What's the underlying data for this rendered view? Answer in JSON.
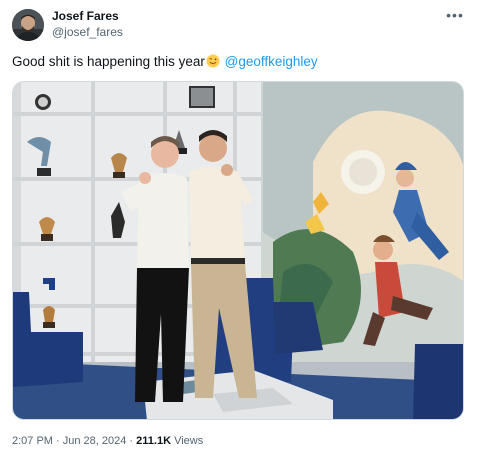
{
  "author": {
    "display_name": "Josef Fares",
    "handle": "@josef_fares"
  },
  "more_icon": "more-horizontal-icon",
  "tweet": {
    "text": "Good shit is happening this year",
    "emoji": "winking-face-with-tongue",
    "mention": "@geoffkeighley"
  },
  "media": {
    "kind": "photo"
  },
  "meta": {
    "time": "2:07 PM",
    "separator1": " · ",
    "date": "Jun 28, 2024",
    "separator2": " · ",
    "views_count": "211.1K",
    "views_label": " Views"
  },
  "colors": {
    "accent": "#1d9bf0",
    "secondary_text": "#536471",
    "border": "#cfd9de"
  }
}
